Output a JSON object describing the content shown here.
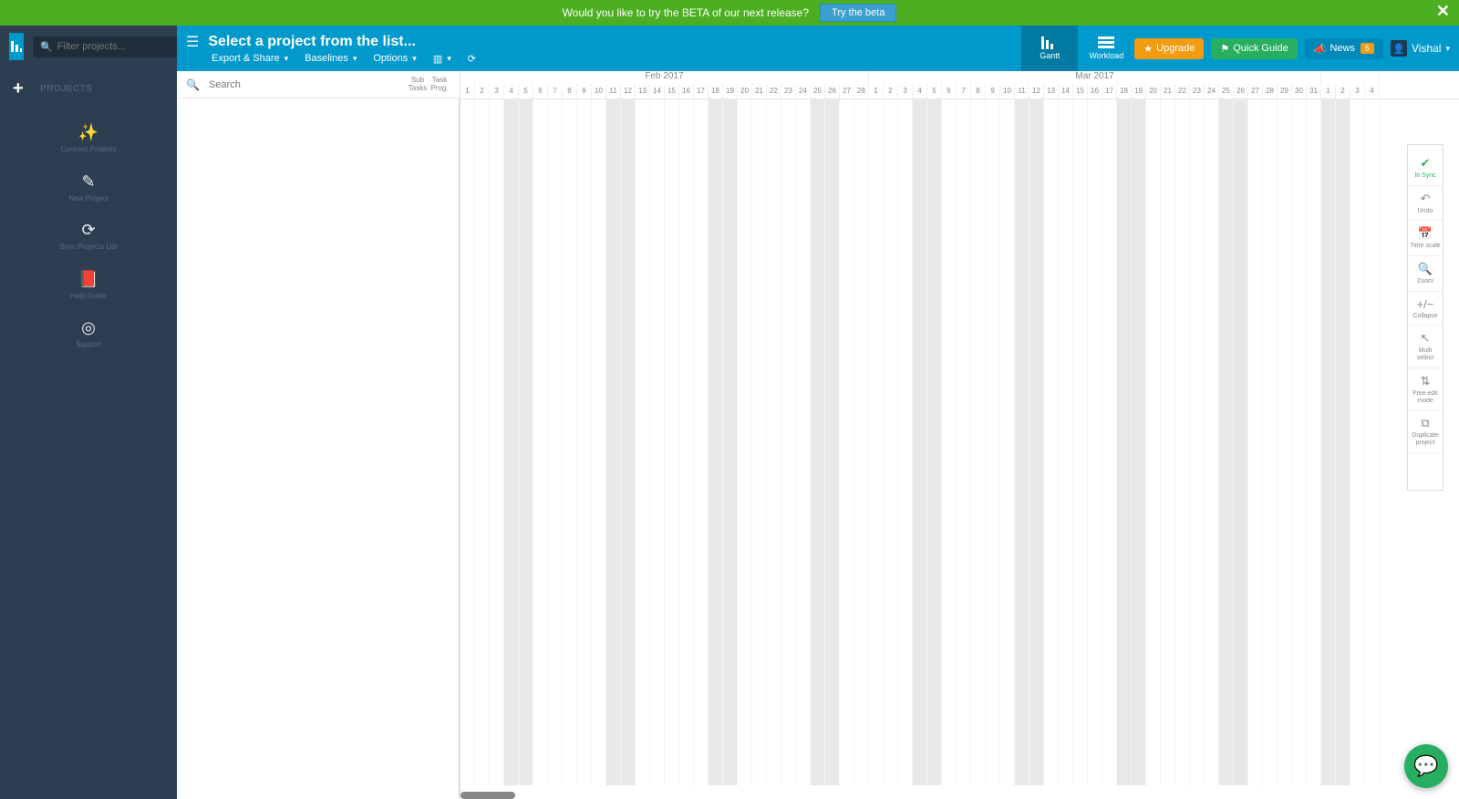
{
  "banner": {
    "text": "Would you like to try the BETA of our next release?",
    "button": "Try the beta"
  },
  "sidebar": {
    "filter_placeholder": "Filter projects...",
    "section_label": "PROJECTS",
    "items": [
      {
        "label": "Connect Projects"
      },
      {
        "label": "New Project"
      },
      {
        "label": "Sync Projects List"
      },
      {
        "label": "Help Guide"
      },
      {
        "label": "Support"
      }
    ]
  },
  "toolbar": {
    "title": "Select a project from the list...",
    "menu": {
      "export": "Export & Share",
      "baselines": "Baselines",
      "options": "Options"
    },
    "views": {
      "gantt": "Gantt",
      "workload": "Workload"
    },
    "upgrade": "Upgrade",
    "quick_guide": "Quick Guide",
    "news": "News",
    "news_count": "5",
    "user": "Vishal"
  },
  "task_panel": {
    "search_placeholder": "Search",
    "col_sub": "Sub Tasks",
    "col_task": "Task Prog."
  },
  "timeline": {
    "months": [
      {
        "label": "Feb 2017",
        "days": 28
      },
      {
        "label": "Mar 2017",
        "days": 31
      }
    ],
    "feb_start_weekday": 3,
    "trailing_days": 4
  },
  "right_tools": {
    "sync": "In Sync",
    "undo": "Undo",
    "timescale": "Time scale",
    "zoom": "Zoom",
    "collapse": "Collapse",
    "multiselect": "Multi select",
    "freeedit": "Free edit mode",
    "duplicate": "Duplicate project"
  }
}
